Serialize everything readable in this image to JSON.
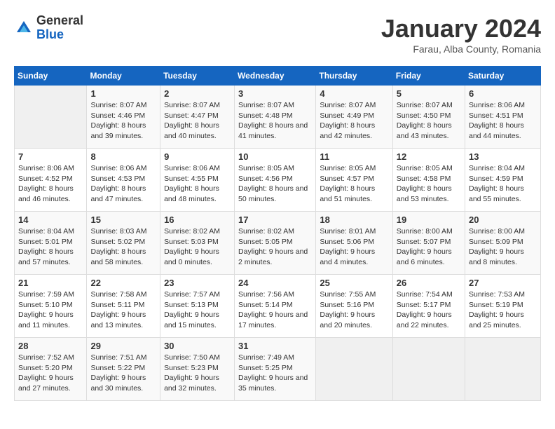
{
  "logo": {
    "general": "General",
    "blue": "Blue"
  },
  "title": "January 2024",
  "subtitle": "Farau, Alba County, Romania",
  "days_of_week": [
    "Sunday",
    "Monday",
    "Tuesday",
    "Wednesday",
    "Thursday",
    "Friday",
    "Saturday"
  ],
  "weeks": [
    [
      {
        "day": "",
        "sunrise": "",
        "sunset": "",
        "daylight": ""
      },
      {
        "day": "1",
        "sunrise": "Sunrise: 8:07 AM",
        "sunset": "Sunset: 4:46 PM",
        "daylight": "Daylight: 8 hours and 39 minutes."
      },
      {
        "day": "2",
        "sunrise": "Sunrise: 8:07 AM",
        "sunset": "Sunset: 4:47 PM",
        "daylight": "Daylight: 8 hours and 40 minutes."
      },
      {
        "day": "3",
        "sunrise": "Sunrise: 8:07 AM",
        "sunset": "Sunset: 4:48 PM",
        "daylight": "Daylight: 8 hours and 41 minutes."
      },
      {
        "day": "4",
        "sunrise": "Sunrise: 8:07 AM",
        "sunset": "Sunset: 4:49 PM",
        "daylight": "Daylight: 8 hours and 42 minutes."
      },
      {
        "day": "5",
        "sunrise": "Sunrise: 8:07 AM",
        "sunset": "Sunset: 4:50 PM",
        "daylight": "Daylight: 8 hours and 43 minutes."
      },
      {
        "day": "6",
        "sunrise": "Sunrise: 8:06 AM",
        "sunset": "Sunset: 4:51 PM",
        "daylight": "Daylight: 8 hours and 44 minutes."
      }
    ],
    [
      {
        "day": "7",
        "sunrise": "Sunrise: 8:06 AM",
        "sunset": "Sunset: 4:52 PM",
        "daylight": "Daylight: 8 hours and 46 minutes."
      },
      {
        "day": "8",
        "sunrise": "Sunrise: 8:06 AM",
        "sunset": "Sunset: 4:53 PM",
        "daylight": "Daylight: 8 hours and 47 minutes."
      },
      {
        "day": "9",
        "sunrise": "Sunrise: 8:06 AM",
        "sunset": "Sunset: 4:55 PM",
        "daylight": "Daylight: 8 hours and 48 minutes."
      },
      {
        "day": "10",
        "sunrise": "Sunrise: 8:05 AM",
        "sunset": "Sunset: 4:56 PM",
        "daylight": "Daylight: 8 hours and 50 minutes."
      },
      {
        "day": "11",
        "sunrise": "Sunrise: 8:05 AM",
        "sunset": "Sunset: 4:57 PM",
        "daylight": "Daylight: 8 hours and 51 minutes."
      },
      {
        "day": "12",
        "sunrise": "Sunrise: 8:05 AM",
        "sunset": "Sunset: 4:58 PM",
        "daylight": "Daylight: 8 hours and 53 minutes."
      },
      {
        "day": "13",
        "sunrise": "Sunrise: 8:04 AM",
        "sunset": "Sunset: 4:59 PM",
        "daylight": "Daylight: 8 hours and 55 minutes."
      }
    ],
    [
      {
        "day": "14",
        "sunrise": "Sunrise: 8:04 AM",
        "sunset": "Sunset: 5:01 PM",
        "daylight": "Daylight: 8 hours and 57 minutes."
      },
      {
        "day": "15",
        "sunrise": "Sunrise: 8:03 AM",
        "sunset": "Sunset: 5:02 PM",
        "daylight": "Daylight: 8 hours and 58 minutes."
      },
      {
        "day": "16",
        "sunrise": "Sunrise: 8:02 AM",
        "sunset": "Sunset: 5:03 PM",
        "daylight": "Daylight: 9 hours and 0 minutes."
      },
      {
        "day": "17",
        "sunrise": "Sunrise: 8:02 AM",
        "sunset": "Sunset: 5:05 PM",
        "daylight": "Daylight: 9 hours and 2 minutes."
      },
      {
        "day": "18",
        "sunrise": "Sunrise: 8:01 AM",
        "sunset": "Sunset: 5:06 PM",
        "daylight": "Daylight: 9 hours and 4 minutes."
      },
      {
        "day": "19",
        "sunrise": "Sunrise: 8:00 AM",
        "sunset": "Sunset: 5:07 PM",
        "daylight": "Daylight: 9 hours and 6 minutes."
      },
      {
        "day": "20",
        "sunrise": "Sunrise: 8:00 AM",
        "sunset": "Sunset: 5:09 PM",
        "daylight": "Daylight: 9 hours and 8 minutes."
      }
    ],
    [
      {
        "day": "21",
        "sunrise": "Sunrise: 7:59 AM",
        "sunset": "Sunset: 5:10 PM",
        "daylight": "Daylight: 9 hours and 11 minutes."
      },
      {
        "day": "22",
        "sunrise": "Sunrise: 7:58 AM",
        "sunset": "Sunset: 5:11 PM",
        "daylight": "Daylight: 9 hours and 13 minutes."
      },
      {
        "day": "23",
        "sunrise": "Sunrise: 7:57 AM",
        "sunset": "Sunset: 5:13 PM",
        "daylight": "Daylight: 9 hours and 15 minutes."
      },
      {
        "day": "24",
        "sunrise": "Sunrise: 7:56 AM",
        "sunset": "Sunset: 5:14 PM",
        "daylight": "Daylight: 9 hours and 17 minutes."
      },
      {
        "day": "25",
        "sunrise": "Sunrise: 7:55 AM",
        "sunset": "Sunset: 5:16 PM",
        "daylight": "Daylight: 9 hours and 20 minutes."
      },
      {
        "day": "26",
        "sunrise": "Sunrise: 7:54 AM",
        "sunset": "Sunset: 5:17 PM",
        "daylight": "Daylight: 9 hours and 22 minutes."
      },
      {
        "day": "27",
        "sunrise": "Sunrise: 7:53 AM",
        "sunset": "Sunset: 5:19 PM",
        "daylight": "Daylight: 9 hours and 25 minutes."
      }
    ],
    [
      {
        "day": "28",
        "sunrise": "Sunrise: 7:52 AM",
        "sunset": "Sunset: 5:20 PM",
        "daylight": "Daylight: 9 hours and 27 minutes."
      },
      {
        "day": "29",
        "sunrise": "Sunrise: 7:51 AM",
        "sunset": "Sunset: 5:22 PM",
        "daylight": "Daylight: 9 hours and 30 minutes."
      },
      {
        "day": "30",
        "sunrise": "Sunrise: 7:50 AM",
        "sunset": "Sunset: 5:23 PM",
        "daylight": "Daylight: 9 hours and 32 minutes."
      },
      {
        "day": "31",
        "sunrise": "Sunrise: 7:49 AM",
        "sunset": "Sunset: 5:25 PM",
        "daylight": "Daylight: 9 hours and 35 minutes."
      },
      {
        "day": "",
        "sunrise": "",
        "sunset": "",
        "daylight": ""
      },
      {
        "day": "",
        "sunrise": "",
        "sunset": "",
        "daylight": ""
      },
      {
        "day": "",
        "sunrise": "",
        "sunset": "",
        "daylight": ""
      }
    ]
  ]
}
